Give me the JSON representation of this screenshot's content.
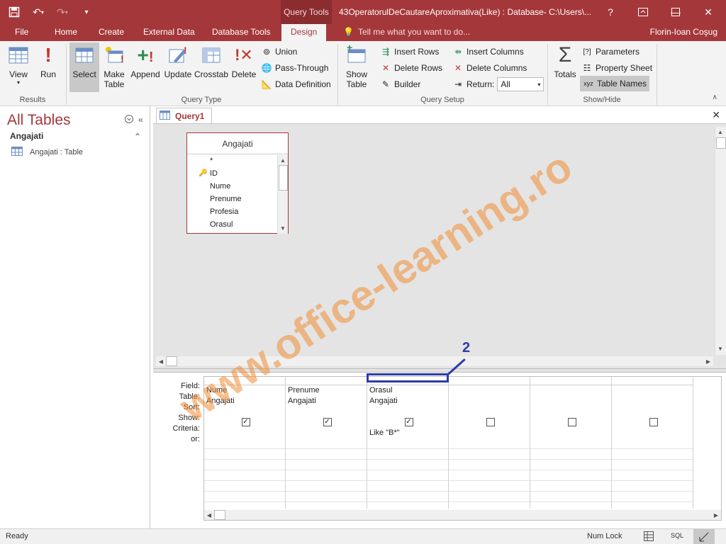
{
  "titlebar": {
    "contextual_tab": "Query Tools",
    "window_title": "43OperatorulDeCautareAproximativa(Like) : Database- C:\\Users\\...",
    "help": "?"
  },
  "tabs": [
    "File",
    "Home",
    "Create",
    "External Data",
    "Database Tools",
    "Design"
  ],
  "active_tab": "Design",
  "tell_me": "Tell me what you want to do...",
  "user_name": "Florin-Ioan Coşug",
  "ribbon": {
    "results": {
      "label": "Results",
      "view": "View",
      "run": "Run"
    },
    "query_type": {
      "label": "Query Type",
      "select": "Select",
      "make_table_1": "Make",
      "make_table_2": "Table",
      "append": "Append",
      "update": "Update",
      "crosstab": "Crosstab",
      "delete": "Delete",
      "union": "Union",
      "pass_through": "Pass-Through",
      "data_definition": "Data Definition"
    },
    "query_setup": {
      "label": "Query Setup",
      "show_table_1": "Show",
      "show_table_2": "Table",
      "insert_rows": "Insert Rows",
      "delete_rows": "Delete Rows",
      "builder": "Builder",
      "insert_columns": "Insert Columns",
      "delete_columns": "Delete Columns",
      "return_label": "Return:",
      "return_value": "All"
    },
    "show_hide": {
      "label": "Show/Hide",
      "totals": "Totals",
      "parameters": "Parameters",
      "property_sheet": "Property Sheet",
      "table_names": "Table Names"
    }
  },
  "nav": {
    "title": "All Tables",
    "group": "Angajati",
    "items": [
      {
        "label": "Angajati : Table"
      }
    ]
  },
  "document": {
    "tab": "Query1",
    "table": {
      "name": "Angajati",
      "fields": [
        "*",
        "ID",
        "Nume",
        "Prenume",
        "Profesia",
        "Orasul"
      ]
    },
    "grid": {
      "row_labels": [
        "Field:",
        "Table:",
        "Sort:",
        "Show:",
        "Criteria:",
        "or:"
      ],
      "columns": [
        {
          "field": "Nume",
          "table": "Angajati",
          "sort": "",
          "show": true,
          "criteria": "",
          "or": ""
        },
        {
          "field": "Prenume",
          "table": "Angajati",
          "sort": "",
          "show": true,
          "criteria": "",
          "or": ""
        },
        {
          "field": "Orasul",
          "table": "Angajati",
          "sort": "",
          "show": true,
          "criteria": "Like \"B*\"",
          "or": ""
        },
        {
          "field": "",
          "table": "",
          "sort": "",
          "show": false,
          "criteria": "",
          "or": ""
        },
        {
          "field": "",
          "table": "",
          "sort": "",
          "show": false,
          "criteria": "",
          "or": ""
        },
        {
          "field": "",
          "table": "",
          "sort": "",
          "show": false,
          "criteria": "",
          "or": ""
        }
      ]
    }
  },
  "status": {
    "ready": "Ready",
    "num_lock": "Num Lock",
    "sql": "SQL"
  },
  "annotation": {
    "number": "2"
  },
  "watermark": "www.office-learning.ro",
  "colors": {
    "accent": "#a4373a",
    "annotation": "#2e3ba8",
    "watermark": "#f08c32"
  }
}
